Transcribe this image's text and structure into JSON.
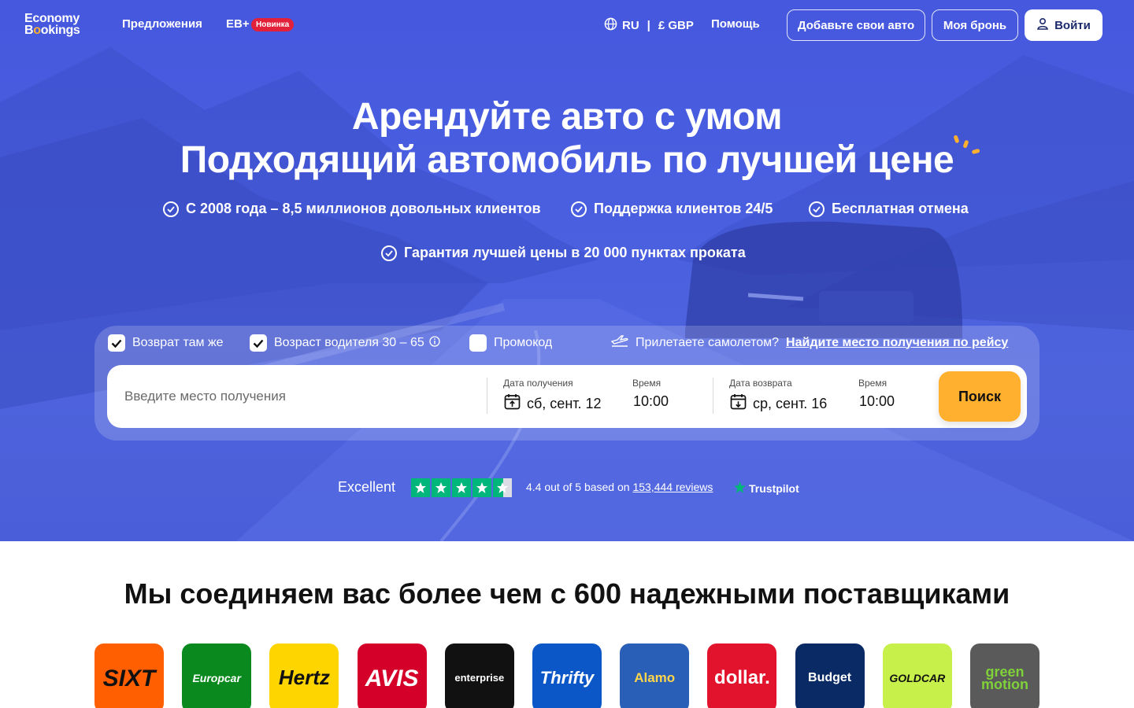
{
  "header": {
    "logo_line1": "Economy",
    "logo_line2_a": "B",
    "logo_line2_b": "o",
    "logo_line2_c": "okings",
    "nav_offers": "Предложения",
    "nav_eb": "EB+",
    "badge_new": "Новинка",
    "lang": "RU",
    "currency": "£ GBP",
    "help": "Помощь",
    "add_car": "Добавьте свои авто",
    "my_booking": "Моя бронь",
    "login": "Войти"
  },
  "hero": {
    "title_line1": "Арендуйте авто с умом",
    "title_line2": "Подходящий автомобиль по лучшей цене",
    "features": [
      "С 2008 года – 8,5 миллионов довольных клиентов",
      "Поддержка клиентов 24/5",
      "Бесплатная отмена",
      "Гарантия лучшей цены в 20 000 пунктах проката"
    ]
  },
  "search": {
    "opt_return_same": "Возврат там же",
    "opt_driver_age": "Возраст водителя 30 – 65",
    "opt_promo": "Промокод",
    "flight_question": "Прилетаете самолетом?",
    "flight_link": "Найдите место получения по рейсу",
    "location_placeholder": "Введите место получения",
    "pickup_date_label": "Дата получения",
    "pickup_date": "сб, сент. 12",
    "pickup_time_label": "Время",
    "pickup_time": "10:00",
    "return_date_label": "Дата возврата",
    "return_date": "ср, сент. 16",
    "return_time_label": "Время",
    "return_time": "10:00",
    "search_button": "Поиск",
    "return_same_checked": true,
    "driver_age_checked": true,
    "promo_checked": false
  },
  "trustpilot": {
    "excellent": "Excellent",
    "rating_text": "4.4 out of 5 based on",
    "reviews": "153,444 reviews",
    "brand": "Trustpilot",
    "rating": 4.4
  },
  "suppliers": {
    "title": "Мы соединяем вас более чем с 600 надежными поставщиками",
    "logos": [
      {
        "name": "SIXT",
        "bg": "#ff5f00",
        "fg": "#111111"
      },
      {
        "name": "Europcar",
        "bg": "#0a8a1e",
        "fg": "#ffffff"
      },
      {
        "name": "Hertz",
        "bg": "#ffd500",
        "fg": "#111111"
      },
      {
        "name": "AVIS",
        "bg": "#d4002a",
        "fg": "#ffffff"
      },
      {
        "name": "enterprise",
        "bg": "#111111",
        "fg": "#ffffff"
      },
      {
        "name": "Thrifty",
        "bg": "#0b57c7",
        "fg": "#ffffff"
      },
      {
        "name": "Alamo",
        "bg": "#2a5fb8",
        "fg": "#ffd54a"
      },
      {
        "name": "dollar.",
        "bg": "#e2142d",
        "fg": "#ffffff"
      },
      {
        "name": "Budget",
        "bg": "#0a2a66",
        "fg": "#ffffff"
      },
      {
        "name": "GOLDCAR",
        "bg": "#c8f04a",
        "fg": "#111111"
      },
      {
        "name": "green motion",
        "bg": "#5a5a5a",
        "fg": "#7fd13a"
      }
    ]
  }
}
